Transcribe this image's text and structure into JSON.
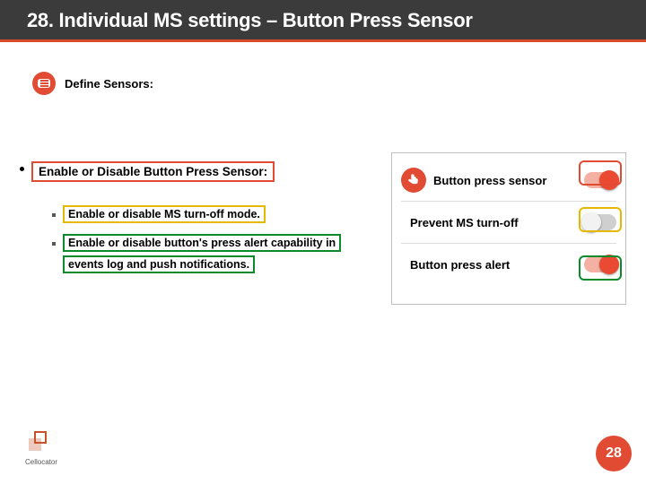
{
  "header": {
    "title": "28. Individual MS settings – Button Press Sensor"
  },
  "define": {
    "label": "Define Sensors:"
  },
  "main_bullet": "Enable or Disable Button Press Sensor:",
  "sub_bullets": {
    "b1_hl": "Enable or disable MS turn-off mode.",
    "b2_hl": "Enable or disable button's press alert capability in",
    "b2_rest": "events log and push notifications."
  },
  "panel": {
    "row1": {
      "label": "Button press sensor",
      "on": true
    },
    "row2": {
      "label": "Prevent MS turn-off",
      "on": false
    },
    "row3": {
      "label": "Button press alert",
      "on": true
    }
  },
  "footer": {
    "brand": "Cellocator",
    "page": "28"
  }
}
